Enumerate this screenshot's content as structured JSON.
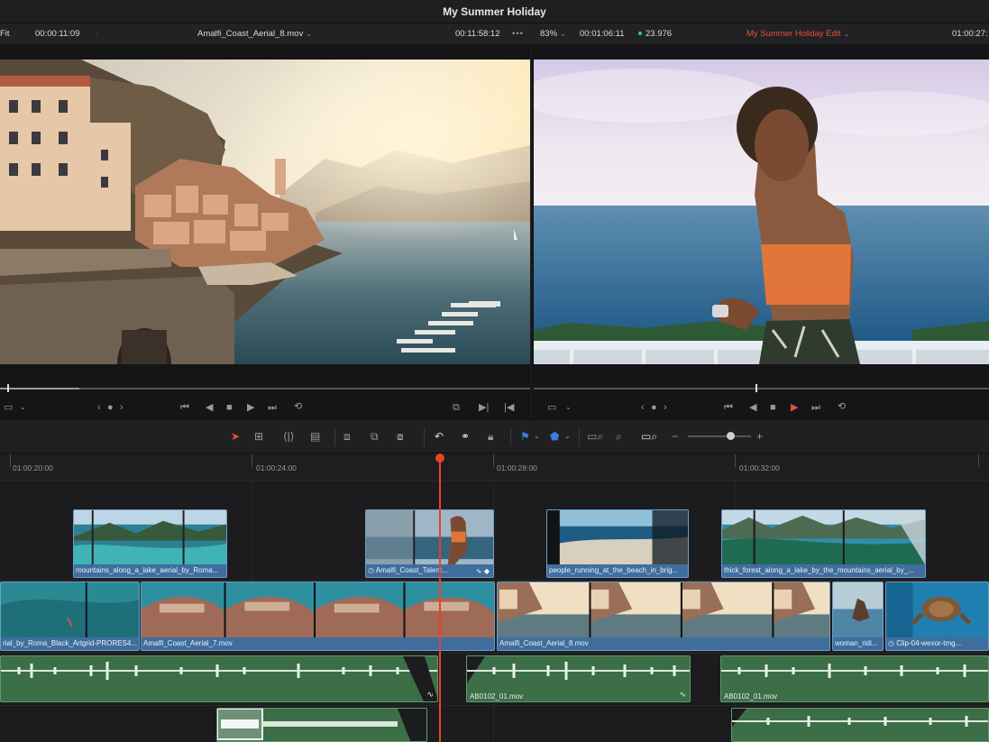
{
  "window": {
    "title": "My Summer Holiday"
  },
  "source_viewer": {
    "zoom": "Fit",
    "timecode": "00:00:11:09",
    "clip_name": "Amalfi_Coast_Aerial_8.mov",
    "duration": "00:11:58:12"
  },
  "timeline_viewer": {
    "zoom": "83%",
    "duration": "00:01:06:11",
    "fps": "23.976",
    "timeline_name": "My Summer Holiday Edit",
    "timecode": "01:00:27:"
  },
  "colors": {
    "accent_red": "#e8513c",
    "clip_blue": "#3f6e9e",
    "audio_green": "#3c6e48",
    "playhead": "#e8412c",
    "flag_blue": "#3d7be0"
  },
  "transport": {
    "source_buttons": [
      "view-mode-icon",
      "jog-left-icon",
      "jog-dot-icon",
      "jog-right-icon",
      "first-frame-icon",
      "play-reverse-icon",
      "stop-icon",
      "play-icon",
      "last-frame-icon",
      "loop-icon",
      "match-frame-icon",
      "next-edit-icon",
      "prev-edit-icon"
    ],
    "timeline_buttons": [
      "view-mode-icon",
      "jog-left-icon",
      "jog-dot-icon",
      "jog-right-icon",
      "first-frame-icon",
      "play-reverse-icon",
      "stop-icon",
      "play-icon",
      "last-frame-icon",
      "loop-icon"
    ]
  },
  "ruler": {
    "timecodes": [
      "01:00:20:00",
      "01:00:24:00",
      "01:00:28:00",
      "01:00:32:00"
    ]
  },
  "video_track_2": [
    {
      "name": "mountains_along_a_lake_aerial_by_Roma..."
    },
    {
      "name": "Amalfi_Coast_Talent..."
    },
    {
      "name": "people_running_at_the_beach_in_brig..."
    },
    {
      "name": "thick_forest_along_a_lake_by_the_mountains_aerial_by_..."
    }
  ],
  "video_track_1": [
    {
      "name": "rial_by_Roma_Black_Artgrid-PRORES4..."
    },
    {
      "name": "Amalfi_Coast_Aerial_7.mov"
    },
    {
      "name": "Amalfi_Coast_Aerial_8.mov"
    },
    {
      "name": "woman_ridi..."
    },
    {
      "name": "Clip-04-wexor-tmg..."
    }
  ],
  "audio_track_1": [
    {
      "name": ""
    },
    {
      "name": "AB0102_01.mov"
    },
    {
      "name": "AB0102_01.mov"
    }
  ]
}
